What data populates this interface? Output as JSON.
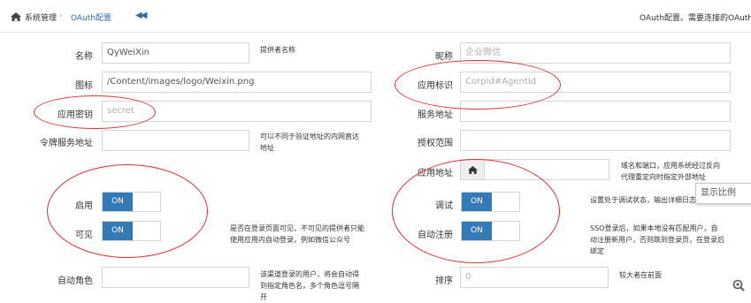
{
  "breadcrumb": {
    "root": "系统管理",
    "current": "OAuth配置"
  },
  "collapse_glyph": "◀◀",
  "notice": "OAuth配置。需要连接的OAuth认",
  "left": {
    "name": {
      "label": "名称",
      "value": "QyWeiXin",
      "hint": "提供者名称"
    },
    "logo": {
      "label": "图标",
      "value": "/Content/images/logo/Weixin.png"
    },
    "secret": {
      "label": "应用密钥",
      "placeholder": "secret"
    },
    "token_url": {
      "label": "令牌服务地址",
      "hint": "可以不同于验证地址的内网直达地址"
    },
    "enable": {
      "label": "启用",
      "state": "ON"
    },
    "visible": {
      "label": "可见",
      "state": "ON",
      "hint": "是否在登录页面可见，不可见的提供者只能使用应用内自动登录，例如微信公众号"
    },
    "auto_role": {
      "label": "自动角色",
      "hint": "该渠道登录的用户，将会自动得到指定角色名，多个角色逗号隔开"
    }
  },
  "right": {
    "nickname": {
      "label": "昵称",
      "placeholder": "企业微信"
    },
    "app_id": {
      "label": "应用标识",
      "placeholder": "CorpId#AgentId"
    },
    "server": {
      "label": "服务地址"
    },
    "scope": {
      "label": "授权范围"
    },
    "app_url": {
      "label": "应用地址",
      "hint": "域名和端口，应用系统经过反向代理重定向时指定外部地址"
    },
    "debug": {
      "label": "调试",
      "state": "ON",
      "hint": "设置处于调试状态，输出详细日志"
    },
    "auto_register": {
      "label": "自动注册",
      "state": "ON",
      "hint": "SSO登录后，如果本地没有匹配用户，自动注册新用户，否则跳到登录页，在登录后绑定"
    },
    "sort": {
      "label": "排序",
      "placeholder": "0",
      "hint": "较大者在前面"
    }
  },
  "tooltip": "显示比例",
  "colors": {
    "accent": "#337ab7",
    "annotation": "#e03030"
  }
}
